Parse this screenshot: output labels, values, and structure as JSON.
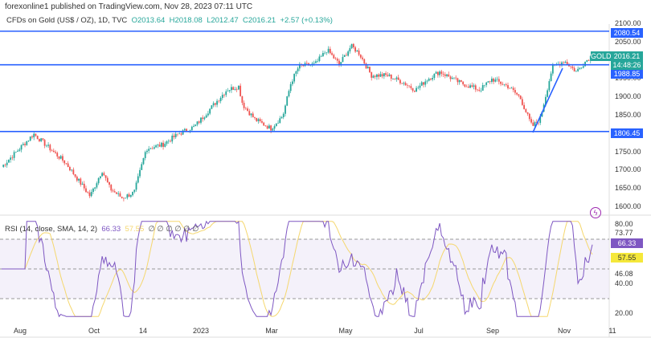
{
  "header": {
    "publisher": "forexonline1 published on TradingView.com, Nov 28, 2023 07:11 UTC"
  },
  "legend": {
    "symbol": "CFDs on Gold (US$ / OZ), 1D, TVC",
    "o": "O2013.64",
    "h": "H2018.08",
    "l": "L2012.47",
    "c": "C2016.21",
    "change": "+2.57 (+0.13%)"
  },
  "price_axis": [
    "2100.00",
    "2050.00",
    "1950.00",
    "1900.00",
    "1850.00",
    "1750.00",
    "1700.00",
    "1650.00",
    "1600.00"
  ],
  "tags": {
    "symbol": "GOLD",
    "last": "2016.21",
    "countdown": "14:48:26",
    "level1": "2080.54",
    "level2": "1988.85",
    "level3": "1806.45"
  },
  "rsi": {
    "label": "RSI (14, close, SMA, 14, 2)",
    "value": "66.33",
    "sma": "57.55",
    "flags": "∅ ∅ ∅ ∅ ∅ ∅",
    "axis": [
      "80.00",
      "73.77",
      "46.08",
      "40.00",
      "20.00"
    ]
  },
  "time_axis": [
    "Aug",
    "Oct",
    "14",
    "2023",
    "Mar",
    "May",
    "Jul",
    "Sep",
    "Nov",
    "11"
  ],
  "colors": {
    "up": "#26a69a",
    "down": "#ef5350",
    "line": "#2962ff",
    "rsi": "#7e57c2",
    "sma": "#f5d76e"
  },
  "chart_data": {
    "type": "candlestick",
    "title": "CFDs on Gold (US$ / OZ), 1D, TVC",
    "ylim": [
      1580,
      2110
    ],
    "horizontal_levels": [
      2080.54,
      1988.85,
      1806.45
    ],
    "trendline": [
      [
        1806,
        "Oct 2023"
      ],
      [
        1990,
        "Oct end 2023"
      ]
    ],
    "price_path": [
      [
        0,
        1710
      ],
      [
        40,
        1800
      ],
      [
        60,
        1760
      ],
      [
        80,
        1720
      ],
      [
        100,
        1660
      ],
      [
        110,
        1630
      ],
      [
        125,
        1700
      ],
      [
        135,
        1650
      ],
      [
        150,
        1625
      ],
      [
        165,
        1640
      ],
      [
        180,
        1760
      ],
      [
        200,
        1770
      ],
      [
        220,
        1800
      ],
      [
        240,
        1820
      ],
      [
        260,
        1870
      ],
      [
        280,
        1920
      ],
      [
        295,
        1930
      ],
      [
        300,
        1880
      ],
      [
        315,
        1840
      ],
      [
        335,
        1815
      ],
      [
        350,
        1850
      ],
      [
        360,
        1940
      ],
      [
        370,
        1985
      ],
      [
        390,
        1990
      ],
      [
        405,
        2030
      ],
      [
        420,
        1990
      ],
      [
        435,
        2040
      ],
      [
        445,
        2020
      ],
      [
        460,
        1960
      ],
      [
        480,
        1960
      ],
      [
        500,
        1940
      ],
      [
        515,
        1920
      ],
      [
        530,
        1950
      ],
      [
        545,
        1970
      ],
      [
        570,
        1940
      ],
      [
        595,
        1920
      ],
      [
        610,
        1950
      ],
      [
        630,
        1930
      ],
      [
        645,
        1900
      ],
      [
        660,
        1820
      ],
      [
        670,
        1840
      ],
      [
        685,
        1980
      ],
      [
        700,
        2000
      ],
      [
        715,
        1970
      ],
      [
        725,
        1995
      ],
      [
        735,
        2016
      ]
    ],
    "rsi_ylim": [
      20,
      80
    ],
    "rsi_bands": [
      70,
      50,
      30
    ]
  }
}
